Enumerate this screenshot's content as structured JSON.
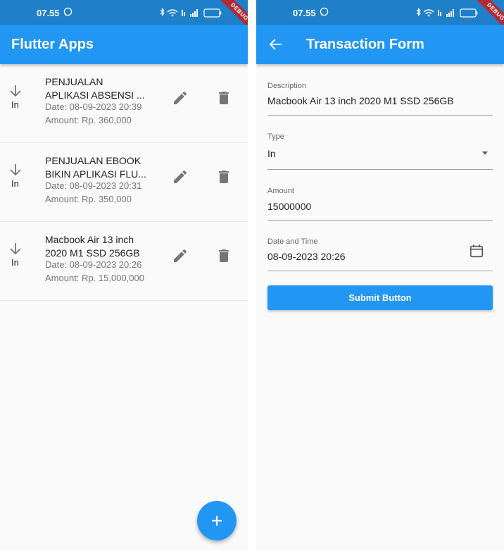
{
  "status_bar": {
    "time": "07.55",
    "battery": "65",
    "debug_banner": "DEBUG"
  },
  "list_screen": {
    "title": "Flutter Apps",
    "transactions": [
      {
        "desc_line1": "PENJUALAN",
        "desc_line2": "APLIKASI ABSENSI ...",
        "type": "In",
        "date": "Date: 08-09-2023 20:39",
        "amount": "Amount: Rp. 360,000"
      },
      {
        "desc_line1": "PENJUALAN EBOOK",
        "desc_line2": "BIKIN APLIKASI FLU...",
        "type": "In",
        "date": "Date: 08-09-2023 20:31",
        "amount": "Amount: Rp. 350,000"
      },
      {
        "desc_line1": "Macbook Air 13 inch",
        "desc_line2": "2020 M1 SSD 256GB",
        "type": "In",
        "date": "Date: 08-09-2023 20:26",
        "amount": "Amount: Rp. 15,000,000"
      }
    ],
    "fab_icon": "add-icon"
  },
  "form_screen": {
    "title": "Transaction Form",
    "description": {
      "label": "Description",
      "value": "Macbook Air 13 inch 2020 M1 SSD 256GB"
    },
    "type": {
      "label": "Type",
      "value": "In"
    },
    "amount": {
      "label": "Amount",
      "value": "15000000"
    },
    "date_time": {
      "label": "Date and Time",
      "value": "08-09-2023 20:26"
    },
    "submit_label": "Submit Button"
  },
  "colors": {
    "primary": "#2196f3",
    "status_bar": "#1f7fc9",
    "icon_grey": "#757575",
    "debug_ribbon": "#b12a35"
  }
}
